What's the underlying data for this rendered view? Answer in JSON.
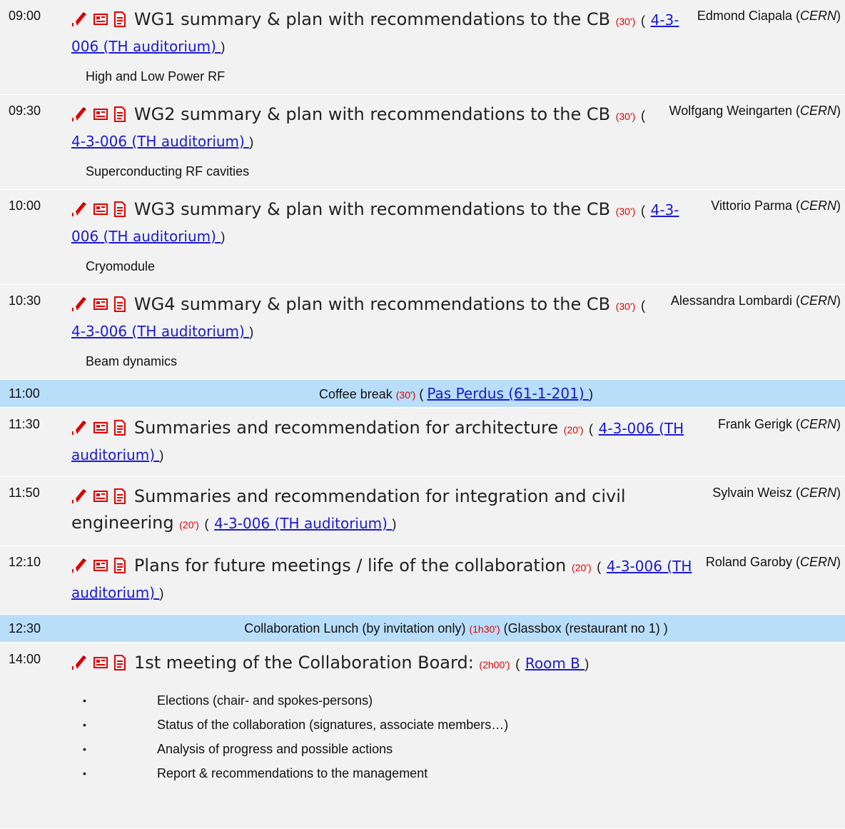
{
  "sessions": [
    {
      "time": "09:00",
      "title": "WG1 summary & plan with recommendations to the CB",
      "duration": "(30')",
      "room": "4-3-006 (TH auditorium) ",
      "speaker": "Edmond Ciapala",
      "affiliation": "CERN",
      "description": "High and Low Power RF"
    },
    {
      "time": "09:30",
      "title": "WG2 summary & plan with recommendations to the CB",
      "duration": "(30')",
      "room": "4-3-006 (TH auditorium) ",
      "speaker": "Wolfgang Weingarten",
      "affiliation": "CERN",
      "description": "Superconducting RF cavities"
    },
    {
      "time": "10:00",
      "title": "WG3 summary & plan with recommendations to the CB",
      "duration": "(30')",
      "room": "4-3-006 (TH auditorium) ",
      "speaker": "Vittorio Parma",
      "affiliation": "CERN",
      "description": "Cryomodule"
    },
    {
      "time": "10:30",
      "title": "WG4 summary & plan with recommendations to the CB",
      "duration": "(30')",
      "room": "4-3-006 (TH auditorium) ",
      "speaker": "Alessandra Lombardi",
      "affiliation": "CERN",
      "description": "Beam dynamics"
    }
  ],
  "coffee": {
    "time": "11:00",
    "title": "Coffee break",
    "duration": "(30')",
    "room": "Pas Perdus (61-1-201) "
  },
  "summaries": [
    {
      "time": "11:30",
      "title": "Summaries and recommendation for architecture",
      "duration": "(20')",
      "room": "4-3-006 (TH auditorium) ",
      "speaker": "Frank Gerigk",
      "affiliation": "CERN"
    },
    {
      "time": "11:50",
      "title": "Summaries and recommendation for integration and civil engineering",
      "duration": "(20')",
      "room": "4-3-006 (TH auditorium) ",
      "speaker": "Sylvain Weisz",
      "affiliation": "CERN"
    },
    {
      "time": "12:10",
      "title": "Plans for future meetings / life of the collaboration",
      "duration": "(20')",
      "room": "4-3-006 (TH auditorium) ",
      "speaker": "Roland Garoby",
      "affiliation": "CERN"
    }
  ],
  "lunch": {
    "time": "12:30",
    "title": "Collaboration Lunch (by invitation only)",
    "duration": "(1h30')",
    "location": "(Glassbox (restaurant no 1) )"
  },
  "board": {
    "time": "14:00",
    "title": "1st meeting of the Collaboration Board:",
    "duration": "(2h00')",
    "room": "Room B ",
    "bullets": [
      "Elections (chair- and spokes-persons)",
      "Status of the collaboration (signatures, associate members…)",
      "Analysis of progress and possible actions",
      "Report & recommendations to the management"
    ]
  },
  "icon_names": [
    "edit-icon",
    "slides-icon",
    "document-icon"
  ],
  "colors": {
    "row_bg": "#f2f2f2",
    "break_bg": "#b9def9",
    "duration": "#e00000",
    "link": "#1a1ad0",
    "icon": "#e00000"
  }
}
